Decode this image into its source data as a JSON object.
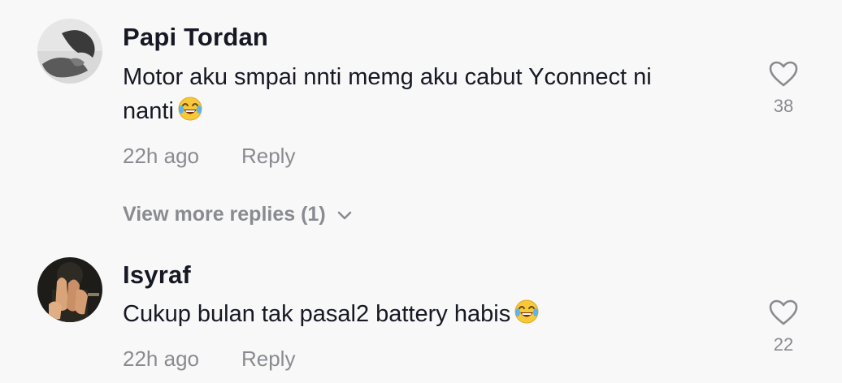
{
  "comments": [
    {
      "username": "Papi Tordan",
      "text_line1": "Motor aku smpai nnti memg aku cabut Yconnect ni",
      "text_line2": "nanti",
      "emoji_icon": "face-with-tears-of-joy-icon",
      "time": "22h ago",
      "reply_label": "Reply",
      "like_count": "38"
    },
    {
      "username": "Isyraf",
      "text_line1": "Cukup bulan tak pasal2 battery habis",
      "emoji_icon": "face-with-tears-of-joy-icon",
      "time": "22h ago",
      "reply_label": "Reply",
      "like_count": "22"
    }
  ],
  "view_more_replies": "View more replies (1)",
  "colors": {
    "background": "#f8f8f8",
    "text_primary": "#161823",
    "text_secondary": "#8a8b91"
  }
}
